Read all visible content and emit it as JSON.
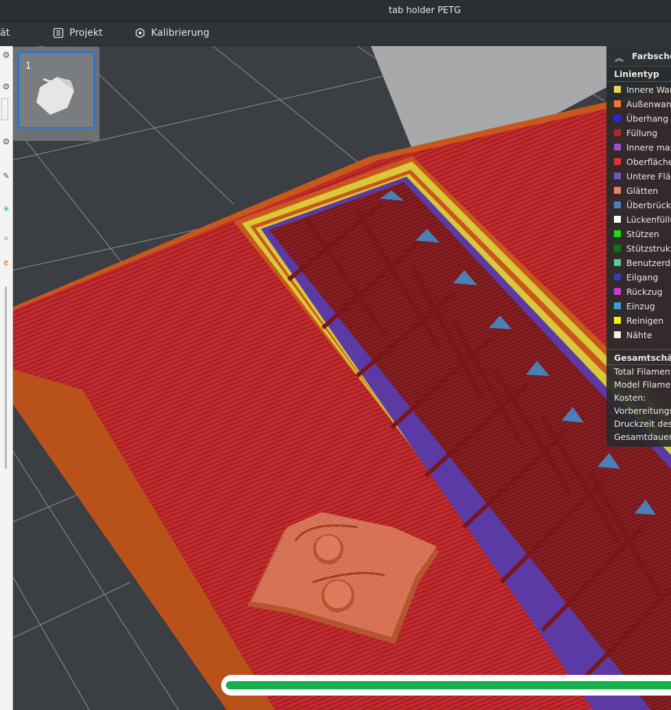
{
  "window": {
    "title": "tab holder PETG"
  },
  "toolbar": {
    "truncated_label": "ät",
    "project_label": "Projekt",
    "calibration_label": "Kalibrierung"
  },
  "leftbar": {
    "icons": [
      "gear-icon",
      "gear-icon",
      "edit-icon",
      "gear-icon",
      "magnifier-icon"
    ],
    "colored_letter": "e"
  },
  "plate": {
    "number": "1"
  },
  "legend": {
    "header": "Farbsche",
    "section_title": "Linientyp",
    "items": [
      {
        "label": "Innere Wan",
        "color": "#e8d94a"
      },
      {
        "label": "Außenwand",
        "color": "#f07a2e"
      },
      {
        "label": "Überhang W",
        "color": "#2727e0"
      },
      {
        "label": "Füllung",
        "color": "#b3262b"
      },
      {
        "label": "Innere mas",
        "color": "#9b4fc8"
      },
      {
        "label": "Oberfläche",
        "color": "#e0322e"
      },
      {
        "label": "Untere Fläc",
        "color": "#6a58c4"
      },
      {
        "label": "Glätten",
        "color": "#f08060"
      },
      {
        "label": "Überbrücku",
        "color": "#4a7fb8"
      },
      {
        "label": "Lückenfüllu",
        "color": "#ffffff"
      },
      {
        "label": "Stützen",
        "color": "#12e012"
      },
      {
        "label": "Stützstrukt",
        "color": "#0e7a0e"
      },
      {
        "label": "Benutzerde",
        "color": "#5ec98f"
      },
      {
        "label": "Eilgang",
        "color": "#3a3aa8"
      },
      {
        "label": "Rückzug",
        "color": "#d23ad0"
      },
      {
        "label": "Einzug",
        "color": "#3aa0c8"
      },
      {
        "label": "Reinigen",
        "color": "#f2f21a"
      },
      {
        "label": "Nähte",
        "color": "#eeeeee"
      }
    ],
    "summary_title": "Gesamtschätz",
    "summary": [
      "Total Filament",
      "Model Filamer",
      "Kosten:",
      "Vorbereitungs",
      "Druckzeit des",
      "Gesamtdauer:"
    ]
  },
  "progress": {
    "value": 1.0
  },
  "colors": {
    "infill": "#b3262b",
    "outer_wall": "#c9561c",
    "inner_wall": "#d9c83a",
    "sparse_infill": "#7a1a1d",
    "overhang": "#5b3aa6"
  }
}
